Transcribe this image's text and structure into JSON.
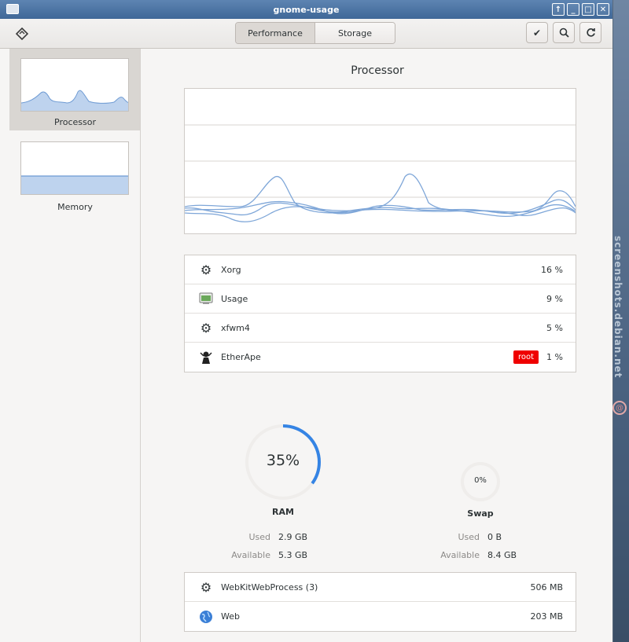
{
  "window": {
    "title": "gnome-usage"
  },
  "header": {
    "tabs": [
      {
        "label": "Performance",
        "active": true
      },
      {
        "label": "Storage",
        "active": false
      }
    ]
  },
  "sidebar": {
    "items": [
      {
        "label": "Processor",
        "selected": true
      },
      {
        "label": "Memory",
        "selected": false
      }
    ]
  },
  "main": {
    "title": "Processor",
    "processes": [
      {
        "name": "Xorg",
        "value": "16 %",
        "icon": "gears-icon"
      },
      {
        "name": "Usage",
        "value": "9 %",
        "icon": "usage-app-icon"
      },
      {
        "name": "xfwm4",
        "value": "5 %",
        "icon": "gears-icon"
      },
      {
        "name": "EtherApe",
        "value": "1 %",
        "icon": "etherape-icon",
        "badge": "root"
      }
    ]
  },
  "memory": {
    "ram": {
      "percent": "35%",
      "percent_value": 35,
      "title": "RAM",
      "used_label": "Used",
      "used": "2.9 GB",
      "available_label": "Available",
      "available": "5.3 GB"
    },
    "swap": {
      "percent": "0%",
      "percent_value": 0,
      "title": "Swap",
      "used_label": "Used",
      "used": "0 B",
      "available_label": "Available",
      "available": "8.4 GB"
    },
    "processes": [
      {
        "name": "WebKitWebProcess (3)",
        "value": "506 MB",
        "icon": "gears-icon"
      },
      {
        "name": "Web",
        "value": "203 MB",
        "icon": "web-globe-icon"
      }
    ]
  },
  "colors": {
    "accent": "#3584e4",
    "graph_line": "#7ea6d8",
    "badge": "#ef0000",
    "titlebar": "#4a72a3"
  },
  "watermark": "screenshots.debian.net"
}
